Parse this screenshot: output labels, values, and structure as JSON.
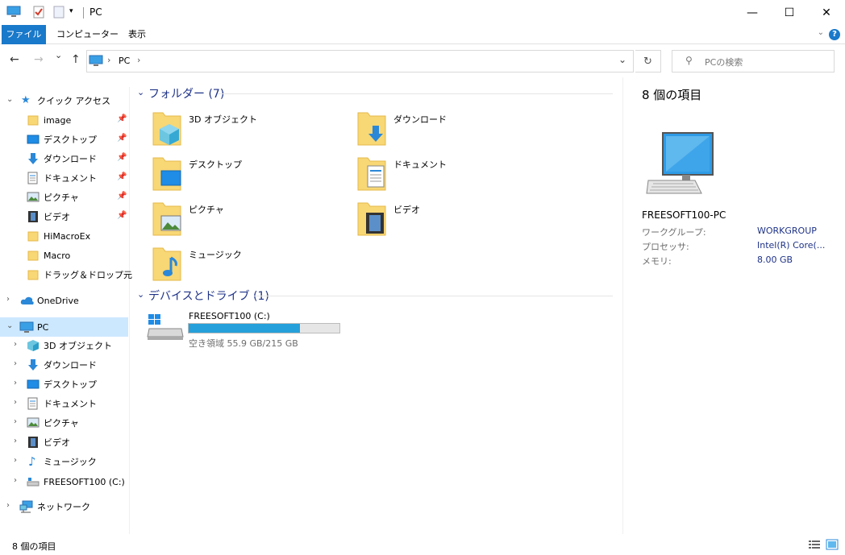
{
  "window": {
    "title": "PC",
    "minimize_glyph": "—",
    "maximize_glyph": "☐",
    "close_glyph": "✕"
  },
  "ribbon": {
    "tabs": [
      "ファイル",
      "コンピューター",
      "表示"
    ],
    "help": "?"
  },
  "navigation": {
    "back": "←",
    "forward": "→",
    "recent": "⌄",
    "up": "↑",
    "breadcrumb": [
      "PC"
    ],
    "search_placeholder": "PCの検索"
  },
  "sidebar": {
    "quick_access": {
      "label": "クイック アクセス",
      "items": [
        {
          "label": "image",
          "icon": "folder-icon",
          "pinned": true
        },
        {
          "label": "デスクトップ",
          "icon": "desktop-icon",
          "pinned": true
        },
        {
          "label": "ダウンロード",
          "icon": "download-icon",
          "pinned": true
        },
        {
          "label": "ドキュメント",
          "icon": "document-icon",
          "pinned": true
        },
        {
          "label": "ピクチャ",
          "icon": "picture-icon",
          "pinned": true
        },
        {
          "label": "ビデオ",
          "icon": "video-icon",
          "pinned": true
        },
        {
          "label": "HiMacroEx",
          "icon": "folder-icon",
          "pinned": false
        },
        {
          "label": "Macro",
          "icon": "folder-icon",
          "pinned": false
        },
        {
          "label": "ドラッグ＆ドロップ元",
          "icon": "folder-icon",
          "pinned": false
        }
      ]
    },
    "onedrive": {
      "label": "OneDrive"
    },
    "pc": {
      "label": "PC",
      "items": [
        {
          "label": "3D オブジェクト",
          "icon": "3d-objects-icon"
        },
        {
          "label": "ダウンロード",
          "icon": "download-icon"
        },
        {
          "label": "デスクトップ",
          "icon": "desktop-icon"
        },
        {
          "label": "ドキュメント",
          "icon": "document-icon"
        },
        {
          "label": "ピクチャ",
          "icon": "picture-icon"
        },
        {
          "label": "ビデオ",
          "icon": "video-icon"
        },
        {
          "label": "ミュージック",
          "icon": "music-icon"
        },
        {
          "label": "FREESOFT100 (C:)",
          "icon": "drive-icon"
        }
      ]
    },
    "network": {
      "label": "ネットワーク"
    }
  },
  "content": {
    "folders_header": "フォルダー (7)",
    "folders": [
      {
        "label": "3D オブジェクト",
        "icon": "3d-objects-icon"
      },
      {
        "label": "ダウンロード",
        "icon": "download-icon"
      },
      {
        "label": "デスクトップ",
        "icon": "desktop-icon"
      },
      {
        "label": "ドキュメント",
        "icon": "document-icon"
      },
      {
        "label": "ピクチャ",
        "icon": "picture-icon"
      },
      {
        "label": "ビデオ",
        "icon": "video-icon"
      },
      {
        "label": "ミュージック",
        "icon": "music-icon"
      }
    ],
    "drives_header": "デバイスとドライブ (1)",
    "drive": {
      "name": "FREESOFT100 (C:)",
      "free_text": "空き領域 55.9 GB/215 GB",
      "used_fraction": 0.74
    }
  },
  "details": {
    "count": "8 個の項目",
    "computer_name": "FREESOFT100-PC",
    "properties": [
      {
        "key": "ワークグループ:",
        "value": "WORKGROUP"
      },
      {
        "key": "プロセッサ:",
        "value": "Intel(R) Core(..."
      },
      {
        "key": "メモリ:",
        "value": "8.00 GB"
      }
    ]
  },
  "status": {
    "text": "8 個の項目"
  },
  "colors": {
    "accent": "#1979ca",
    "selected": "#cce8ff",
    "header_text": "#1e3287",
    "drive_bar": "#26a0da",
    "folder": "#f8d775"
  }
}
